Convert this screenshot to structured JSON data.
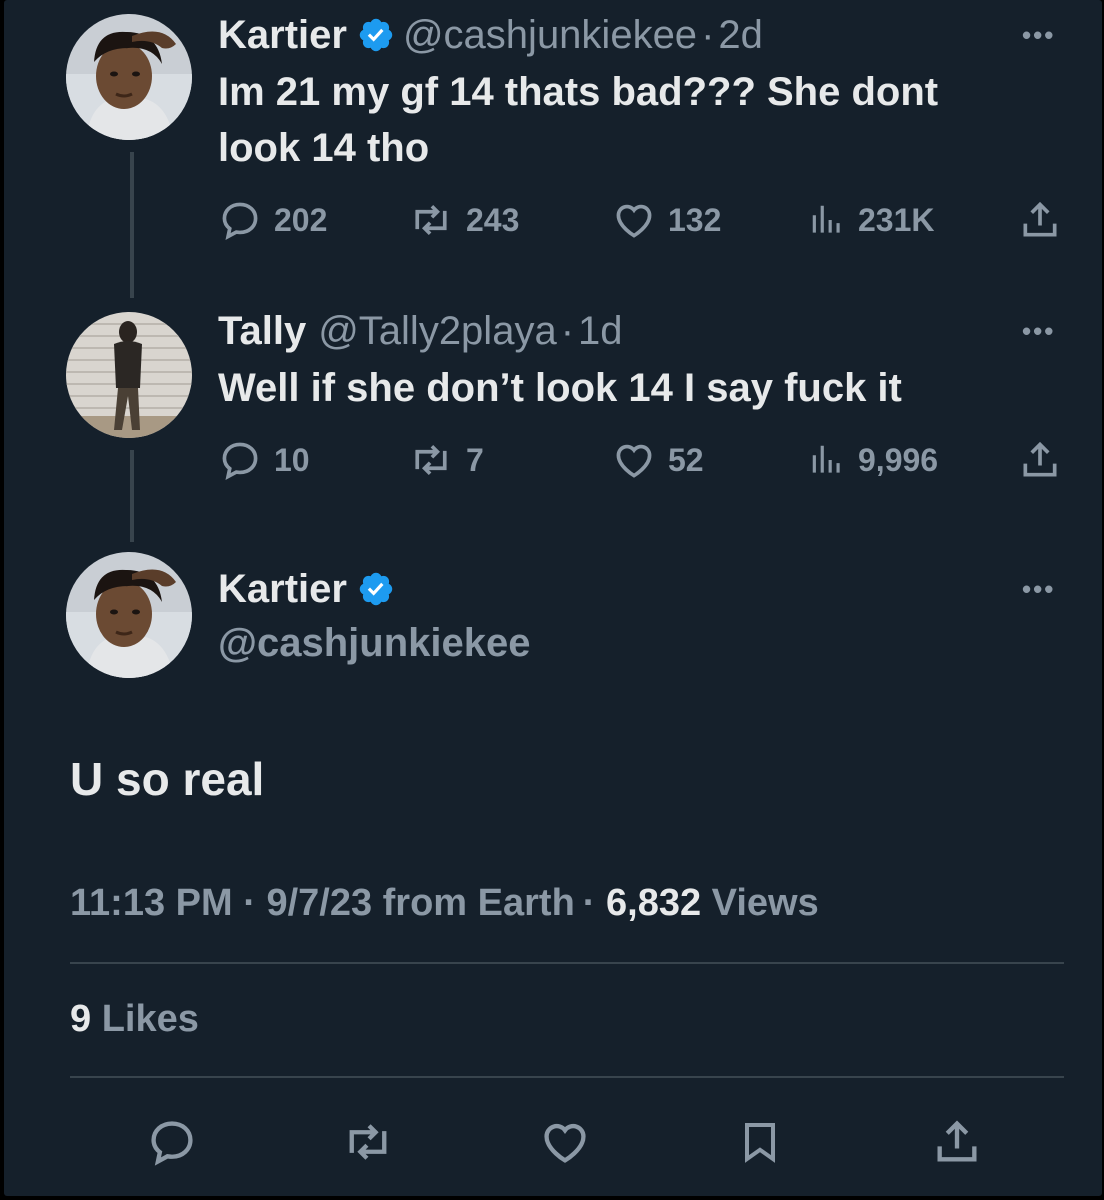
{
  "thread": [
    {
      "display_name": "Kartier",
      "verified": true,
      "handle": "@cashjunkiekee",
      "separator": "·",
      "time": "2d",
      "text_line1": "Im 21 my gf 14 thats bad??? She dont",
      "text_line2": "look 14 tho",
      "replies": "202",
      "retweets": "243",
      "likes": "132",
      "views": "231K"
    },
    {
      "display_name": "Tally",
      "handle": "@Tally2playa",
      "separator": "·",
      "time": "1d",
      "text": "Well if she don’t look 14 I say fuck it",
      "replies": "10",
      "retweets": "7",
      "likes": "52",
      "views": "9,996"
    }
  ],
  "main_tweet": {
    "display_name": "Kartier",
    "verified": true,
    "handle": "@cashjunkiekee",
    "text": "U so real",
    "time": "11:13 PM",
    "separator": "·",
    "date": "9/7/23",
    "source": "from Earth",
    "views_count": "6,832",
    "views_label": "Views",
    "likes_count": "9",
    "likes_label": "Likes"
  },
  "more_label": "•••",
  "colors": {
    "background": "#15202b",
    "text": "#e7e9ea",
    "muted": "#8b98a5",
    "verified": "#1d9bf0",
    "divider": "#38444d"
  }
}
